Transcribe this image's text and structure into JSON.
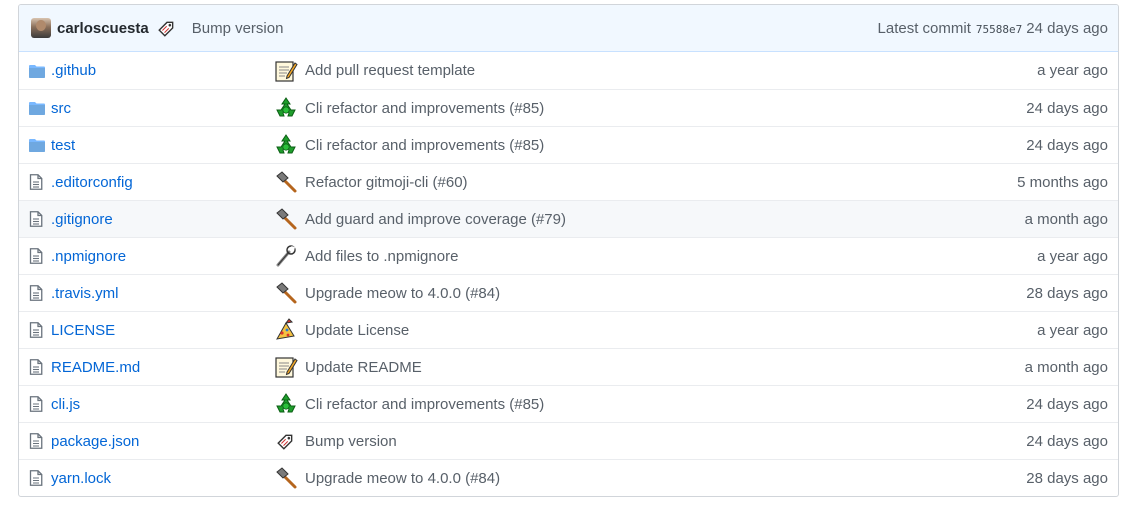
{
  "latest_commit": {
    "author": "carloscuesta",
    "emoji_icon": "bookmark-tag-icon",
    "message": "Bump version",
    "label": "Latest commit",
    "sha": "75588e7",
    "age": "24 days ago"
  },
  "colors": {
    "link": "#0366d6",
    "muted": "#586069",
    "commit_bar_bg": "#f1f8ff",
    "folder": "#79b8ff"
  },
  "files": [
    {
      "type": "folder-icon",
      "name": ".github",
      "emoji_icon": "memo-icon",
      "message": "Add pull request template",
      "age": "a year ago"
    },
    {
      "type": "folder-icon",
      "name": "src",
      "emoji_icon": "recycle-icon",
      "message": "Cli refactor and improvements (#85)",
      "age": "24 days ago"
    },
    {
      "type": "folder-icon",
      "name": "test",
      "emoji_icon": "recycle-icon",
      "message": "Cli refactor and improvements (#85)",
      "age": "24 days ago"
    },
    {
      "type": "file-icon",
      "name": ".editorconfig",
      "emoji_icon": "hammer-icon",
      "message": "Refactor gitmoji-cli (#60)",
      "age": "5 months ago"
    },
    {
      "type": "file-icon",
      "name": ".gitignore",
      "emoji_icon": "hammer-icon",
      "message": "Add guard and improve coverage (#79)",
      "age": "a month ago"
    },
    {
      "type": "file-icon",
      "name": ".npmignore",
      "emoji_icon": "wrench-icon",
      "message": "Add files to .npmignore",
      "age": "a year ago"
    },
    {
      "type": "file-icon",
      "name": ".travis.yml",
      "emoji_icon": "hammer-icon",
      "message": "Upgrade meow to 4.0.0 (#84)",
      "age": "28 days ago"
    },
    {
      "type": "file-icon",
      "name": "LICENSE",
      "emoji_icon": "page-icon",
      "message": "Update License",
      "age": "a year ago"
    },
    {
      "type": "file-icon",
      "name": "README.md",
      "emoji_icon": "memo-icon",
      "message": "Update README",
      "age": "a month ago"
    },
    {
      "type": "file-icon",
      "name": "cli.js",
      "emoji_icon": "recycle-icon",
      "message": "Cli refactor and improvements (#85)",
      "age": "24 days ago"
    },
    {
      "type": "file-icon",
      "name": "package.json",
      "emoji_icon": "bookmark-tag-icon",
      "message": "Bump version",
      "age": "24 days ago"
    },
    {
      "type": "file-icon",
      "name": "yarn.lock",
      "emoji_icon": "hammer-icon",
      "message": "Upgrade meow to 4.0.0 (#84)",
      "age": "28 days ago"
    }
  ]
}
